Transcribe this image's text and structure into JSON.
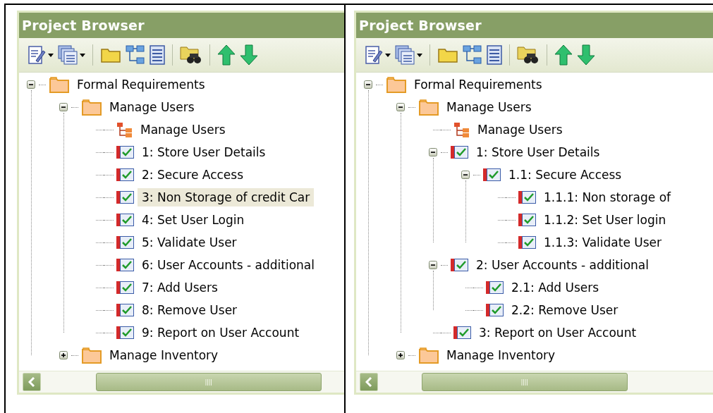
{
  "panels": [
    {
      "title": "Project Browser",
      "tree": [
        {
          "kind": "folder",
          "label": "Formal Requirements",
          "expanded": true,
          "selected": false,
          "children": [
            {
              "kind": "folder",
              "label": "Manage Users",
              "expanded": true,
              "selected": false,
              "children": [
                {
                  "kind": "diagram",
                  "label": "Manage Users",
                  "selected": false
                },
                {
                  "kind": "requirement",
                  "label": "1: Store User Details",
                  "selected": false
                },
                {
                  "kind": "requirement",
                  "label": "2: Secure Access",
                  "selected": false
                },
                {
                  "kind": "requirement",
                  "label": "3: Non Storage of credit Car",
                  "selected": true
                },
                {
                  "kind": "requirement",
                  "label": "4: Set User Login",
                  "selected": false
                },
                {
                  "kind": "requirement",
                  "label": "5: Validate User",
                  "selected": false
                },
                {
                  "kind": "requirement",
                  "label": "6: User Accounts - additional",
                  "selected": false
                },
                {
                  "kind": "requirement",
                  "label": "7: Add Users",
                  "selected": false
                },
                {
                  "kind": "requirement",
                  "label": "8: Remove User",
                  "selected": false
                },
                {
                  "kind": "requirement",
                  "label": "9: Report on User Account",
                  "selected": false
                }
              ]
            },
            {
              "kind": "folder",
              "label": "Manage Inventory",
              "expanded": false,
              "selected": false
            }
          ]
        }
      ]
    },
    {
      "title": "Project Browser",
      "tree": [
        {
          "kind": "folder",
          "label": "Formal Requirements",
          "expanded": true,
          "selected": false,
          "children": [
            {
              "kind": "folder",
              "label": "Manage Users",
              "expanded": true,
              "selected": false,
              "children": [
                {
                  "kind": "diagram",
                  "label": "Manage Users",
                  "selected": false
                },
                {
                  "kind": "requirement",
                  "label": "1: Store User Details",
                  "expanded": true,
                  "selected": false,
                  "children": [
                    {
                      "kind": "requirement",
                      "label": "1.1: Secure Access",
                      "expanded": true,
                      "selected": false,
                      "children": [
                        {
                          "kind": "requirement",
                          "label": "1.1.1: Non storage of",
                          "selected": false
                        },
                        {
                          "kind": "requirement",
                          "label": "1.1.2: Set User login",
                          "selected": false
                        },
                        {
                          "kind": "requirement",
                          "label": "1.1.3: Validate User",
                          "selected": false
                        }
                      ]
                    }
                  ]
                },
                {
                  "kind": "requirement",
                  "label": "2: User Accounts - additional",
                  "expanded": true,
                  "selected": false,
                  "children": [
                    {
                      "kind": "requirement",
                      "label": "2.1: Add Users",
                      "selected": false
                    },
                    {
                      "kind": "requirement",
                      "label": "2.2: Remove User",
                      "selected": false
                    }
                  ]
                },
                {
                  "kind": "requirement",
                  "label": "3: Report on User Account",
                  "selected": false
                }
              ]
            },
            {
              "kind": "folder",
              "label": "Manage Inventory",
              "expanded": false,
              "selected": false
            }
          ]
        }
      ]
    }
  ]
}
